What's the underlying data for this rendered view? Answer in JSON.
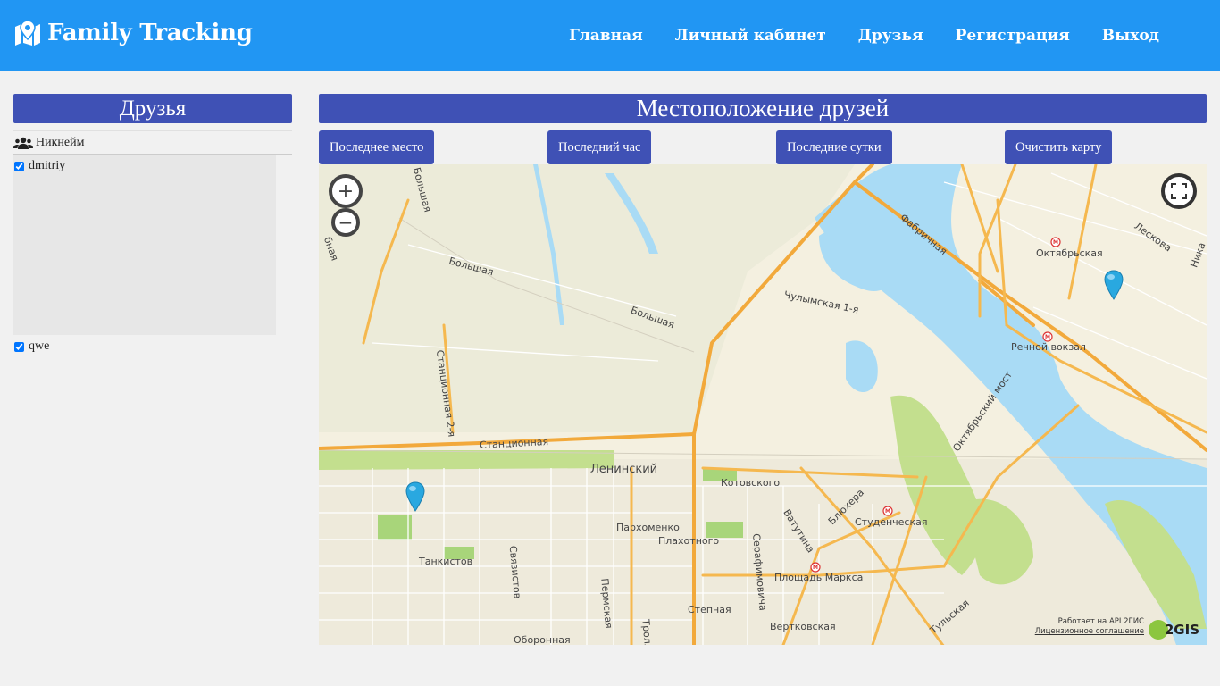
{
  "navbar": {
    "brand": "Family Tracking",
    "links": [
      "Главная",
      "Личный кабинет",
      "Друзья",
      "Регистрация",
      "Выход"
    ],
    "color": "#2196f3"
  },
  "friends": {
    "title": "Друзья",
    "column_header": "Никнейм",
    "items": [
      {
        "name": "dmitriy",
        "checked": true
      },
      {
        "name": "qwe",
        "checked": true
      }
    ]
  },
  "map_panel": {
    "title": "Местоположение друзей",
    "buttons": [
      "Последнее место",
      "Последний час",
      "Последние сутки",
      "Очистить карту"
    ],
    "accent": "#3f51b5",
    "attribution_line1": "Работает на API 2ГИС",
    "attribution_line2": "Лицензионное соглашение",
    "logo_text": "2GIS",
    "labels": {
      "l1": "Большая",
      "l2": "Большая",
      "l3": "Большая",
      "l4": "Станционная 2-я",
      "l5": "Станционная",
      "l6": "Ленинский",
      "l7": "Котовского",
      "l8": "Пархоменко",
      "l9": "Плахотного",
      "l10": "Танкистов",
      "l11": "Связистов",
      "l12": "Пермская",
      "l13": "Степная",
      "l14": "Оборонная",
      "l15": "Площадь Маркса",
      "l16": "Вертковская",
      "l17": "Ватутина",
      "l18": "Блюхера",
      "l19": "Серафимовича",
      "l20": "Студенческая",
      "l21": "Тульская",
      "l22": "Октябрьский мост",
      "l23": "Речной вокзал",
      "l24": "Октябрьская",
      "l25": "Лескова",
      "l26": "Чулымская 1-я",
      "l27": "Фабричная",
      "l28": "Тролл",
      "l29": "Ника",
      "l30": "бная"
    }
  }
}
